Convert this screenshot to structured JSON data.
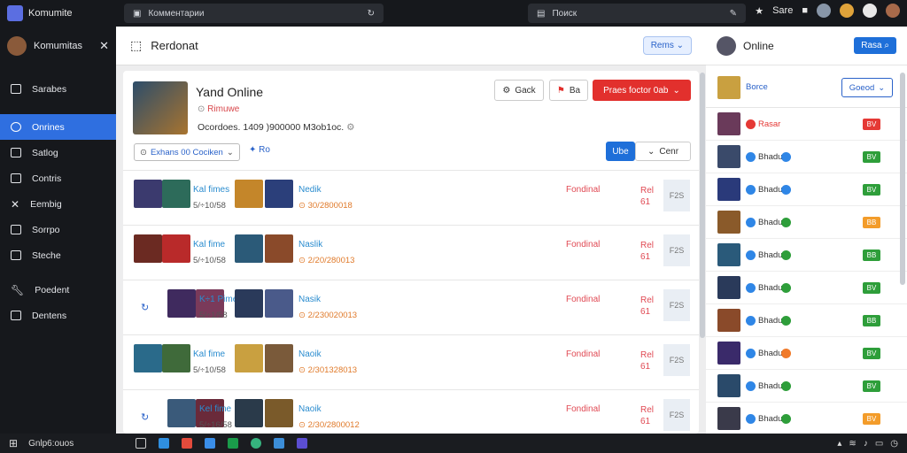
{
  "topbar": {
    "app_name": "Komumite",
    "search1": "Комментарии",
    "search2": "Поиск",
    "right_label": "Sare"
  },
  "sidebar": {
    "title": "Komumitas",
    "items": [
      {
        "label": "Sarabes"
      },
      {
        "label": "Onrines"
      },
      {
        "label": "Satlog"
      },
      {
        "label": "Contris"
      },
      {
        "label": "Eembig"
      },
      {
        "label": "Sorrpo"
      },
      {
        "label": "Steche"
      },
      {
        "label": "Poedent"
      },
      {
        "label": "Dentens"
      }
    ]
  },
  "main": {
    "header_title": "Rerdonat",
    "header_button": "Rems",
    "hero_title": "Yand Online",
    "hero_sub": "Rimuwe",
    "hero_desc": "Ocordoes. 1409 )900000 M3ob1oc.",
    "btn_gear": "Gack",
    "btn_flag": "Ba",
    "btn_red": "Praes foctor 0ab",
    "chip": "Exhans 00 Cociken",
    "pin_label": "Ro",
    "seg_a": "Ube",
    "seg_b": "Cenr",
    "rows": [
      {
        "name1": "Kal fimes",
        "time1": "5/÷10/58",
        "name2": "Nedik",
        "code": "30/2800018",
        "status": "Fondinal",
        "mid": "Rel 61",
        "side": "F2S"
      },
      {
        "name1": "Kal fime",
        "time1": "5/÷10/58",
        "name2": "Naslik",
        "code": "2/20/280013",
        "status": "Fondinal",
        "mid": "Rel 61",
        "side": "F2S"
      },
      {
        "name1": "K÷1 Pime",
        "time1": "5/÷1/58",
        "name2": "Nasik",
        "code": "2/230020013",
        "status": "Fondinal",
        "mid": "Rel 61",
        "side": "F2S"
      },
      {
        "name1": "Kal fime",
        "time1": "5/÷10/58",
        "name2": "Naoik",
        "code": "2/301328013",
        "status": "Fondinal",
        "mid": "Rel 61",
        "side": "F2S"
      },
      {
        "name1": "Kel fime",
        "time1": "5/÷16/58",
        "name2": "Naoik",
        "code": "2/30/2800012",
        "status": "Fondinal",
        "mid": "Rel 61",
        "side": "F2S"
      }
    ]
  },
  "online": {
    "title": "Online",
    "button": "Rasa",
    "filter_label": "Borce",
    "filter_value": "Goeod",
    "rows": [
      {
        "label": "Rasar",
        "badge": "BV",
        "color": "#e53935"
      },
      {
        "label": "Bhadu",
        "badge": "BV",
        "color": "#2e9e3a"
      },
      {
        "label": "Bhadu",
        "badge": "BV",
        "color": "#2e9e3a"
      },
      {
        "label": "Bhadu",
        "badge": "BB",
        "color": "#f39c2a"
      },
      {
        "label": "Bhadu",
        "badge": "BB",
        "color": "#2e9e3a"
      },
      {
        "label": "Bhadu",
        "badge": "BV",
        "color": "#2e9e3a"
      },
      {
        "label": "Bhadu",
        "badge": "BB",
        "color": "#2e9e3a"
      },
      {
        "label": "Bhadu",
        "badge": "BV",
        "color": "#2e9e3a"
      },
      {
        "label": "Bhadu",
        "badge": "BV",
        "color": "#2e9e3a"
      },
      {
        "label": "Bhadu",
        "badge": "BV",
        "color": "#f39c2a"
      }
    ]
  },
  "taskbar": {
    "label": "Gnlp6:ouos"
  }
}
